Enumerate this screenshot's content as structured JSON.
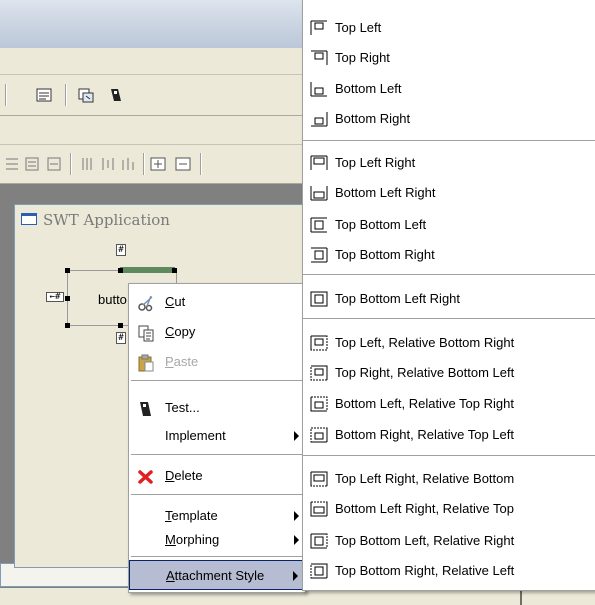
{
  "swt_window": {
    "title": "SWT Application",
    "widget_text": "butto"
  },
  "context_menu": {
    "items": [
      {
        "label": "Cut",
        "icon": "scissors-icon",
        "accelerator": "C",
        "enabled": true,
        "submenu": false
      },
      {
        "label": "Copy",
        "icon": "copy-icon",
        "accelerator": "C",
        "enabled": true,
        "submenu": false
      },
      {
        "label": "Paste",
        "icon": "paste-icon",
        "accelerator": "P",
        "enabled": false,
        "submenu": false
      },
      {
        "label": "Test...",
        "icon": "test-icon",
        "enabled": true,
        "submenu": false
      },
      {
        "label": "Implement",
        "icon": "",
        "enabled": true,
        "submenu": true
      },
      {
        "label": "Delete",
        "icon": "delete-icon",
        "accelerator": "D",
        "enabled": true,
        "submenu": false
      },
      {
        "label": "Template",
        "icon": "",
        "accelerator": "T",
        "enabled": true,
        "submenu": true
      },
      {
        "label": "Morphing",
        "icon": "",
        "accelerator": "M",
        "enabled": true,
        "submenu": true
      },
      {
        "label": "Attachment Style",
        "icon": "",
        "accelerator": "A",
        "enabled": true,
        "submenu": true,
        "selected": true
      }
    ]
  },
  "attachment_submenu": {
    "items": [
      {
        "label": "Top Left"
      },
      {
        "label": "Top Right"
      },
      {
        "label": "Bottom Left"
      },
      {
        "label": "Bottom Right"
      },
      {
        "label": "Top Left Right"
      },
      {
        "label": "Bottom Left Right"
      },
      {
        "label": "Top Bottom Left"
      },
      {
        "label": "Top Bottom Right"
      },
      {
        "label": "Top Bottom Left Right"
      },
      {
        "label": "Top Left, Relative Bottom Right"
      },
      {
        "label": "Top Right, Relative Bottom Left"
      },
      {
        "label": "Bottom Left, Relative Top Right"
      },
      {
        "label": "Bottom Right, Relative Top Left"
      },
      {
        "label": "Top Left Right, Relative Bottom"
      },
      {
        "label": "Bottom Left Right, Relative Top"
      },
      {
        "label": "Top Bottom Left, Relative Right"
      },
      {
        "label": "Top Bottom Right, Relative Left"
      }
    ]
  },
  "colors": {
    "menu_highlight": "#b6bdd2",
    "disabled_text": "#a7a7a7",
    "delete_icon": "#e02020",
    "canvas": "#808080"
  }
}
